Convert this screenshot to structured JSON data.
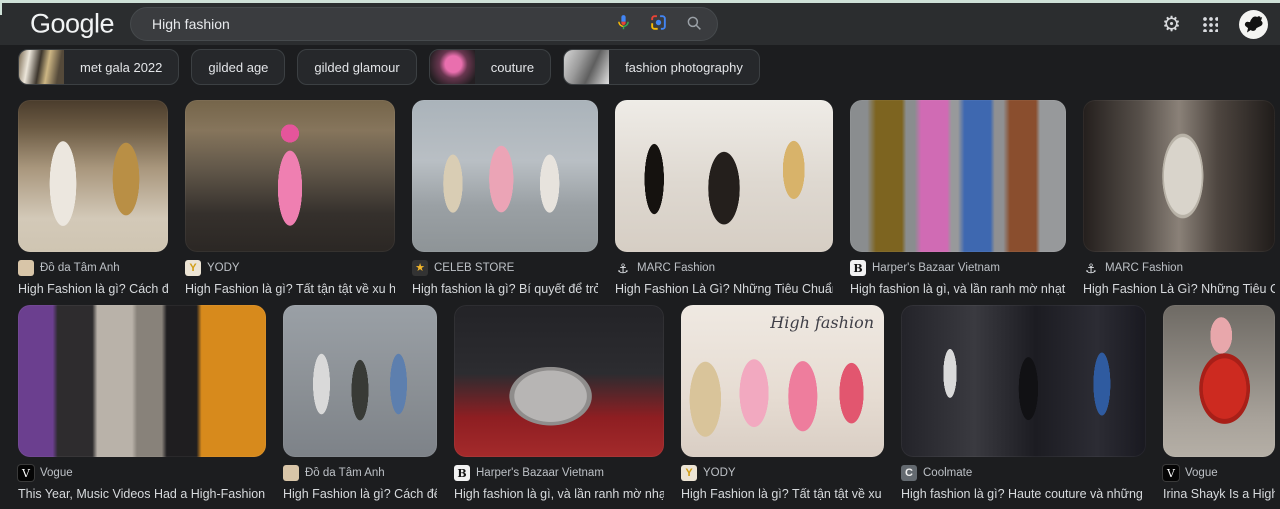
{
  "window": {
    "edge_strip_color": "#cfe1d8"
  },
  "topbar": {
    "logo_text": "Google",
    "search_value": "High fashion",
    "gear_glyph": "⚙",
    "icons": [
      "microphone-icon",
      "camera-lens-icon",
      "search-icon",
      "settings-gear-icon",
      "apps-grid-icon",
      "user-avatar"
    ]
  },
  "chips": [
    {
      "label": "met gala 2022",
      "has_thumb": true
    },
    {
      "label": "gilded age",
      "has_thumb": false
    },
    {
      "label": "gilded glamour",
      "has_thumb": false
    },
    {
      "label": "couture",
      "has_thumb": true
    },
    {
      "label": "fashion photography",
      "has_thumb": true
    }
  ],
  "results": {
    "row1": [
      {
        "source": "Đồ da Tâm Anh",
        "title": "High Fashion là gì? Cách để ...",
        "fav_glyph": "",
        "fav_style": "background:#d8c5a8"
      },
      {
        "source": "YODY",
        "title": "High Fashion là gì? Tất tận tật về xu hướ...",
        "fav_glyph": "Y",
        "fav_style": "background:#ece4d4;color:#d19e16;font-weight:bold"
      },
      {
        "source": "CELEB STORE",
        "title": "High fashion là gì? Bí quyết để trở thà...",
        "fav_glyph": "★",
        "fav_style": "background:#333333;color:#f3b62a"
      },
      {
        "source": "MARC Fashion",
        "title": "High Fashion Là Gì? Những Tiêu Chuẩn Và ...",
        "fav_glyph": "⚓",
        "fav_style": "background:transparent;color:#dfe2e6;font-size:13px"
      },
      {
        "source": "Harper's Bazaar Vietnam",
        "title": "High fashion là gì, và lần ranh mờ nhạt với ...",
        "fav_glyph": "B",
        "fav_style": "background:#f2f2f2;color:#141414;font-family:'DejaVu Serif',serif;font-weight:bold"
      },
      {
        "source": "MARC Fashion",
        "title": "High Fashion Là Gì? Những Tiêu Chuẩ...",
        "fav_glyph": "⚓",
        "fav_style": "background:transparent;color:#dfe2e6;font-size:13px"
      }
    ],
    "row2": [
      {
        "source": "Vogue",
        "title": "This Year, Music Videos Had a High-Fashion Reviv...",
        "fav_glyph": "V",
        "fav_style": "background:#050505;color:#ffffff;font-family:'DejaVu Serif',serif;box-shadow:0 0 0 1px #3a3a3a"
      },
      {
        "source": "Đồ da Tâm Anh",
        "title": "High Fashion là gì? Cách để t...",
        "fav_glyph": "",
        "fav_style": "background:#d8c5a8"
      },
      {
        "source": "Harper's Bazaar Vietnam",
        "title": "High fashion là gì, và lần ranh mờ nhạt ...",
        "fav_glyph": "B",
        "fav_style": "background:#f2f2f2;color:#141414;font-family:'DejaVu Serif',serif;font-weight:bold"
      },
      {
        "source": "YODY",
        "title": "High Fashion là gì? Tất tận tật về xu hư...",
        "fav_glyph": "Y",
        "fav_style": "background:#ece4d4;color:#d19e16;font-weight:bold",
        "overlay_text": "High fashion"
      },
      {
        "source": "Coolmate",
        "title": "High fashion là gì? Haute couture và những quy tắ...",
        "fav_glyph": "C",
        "fav_style": "background:#646a70;color:#f0f0f0;font-weight:bold"
      },
      {
        "source": "Vogue",
        "title": "Irina Shayk Is a High-F...",
        "fav_glyph": "V",
        "fav_style": "background:#050505;color:#ffffff;font-family:'DejaVu Serif',serif;box-shadow:0 0 0 1px #3a3a3a"
      }
    ]
  }
}
